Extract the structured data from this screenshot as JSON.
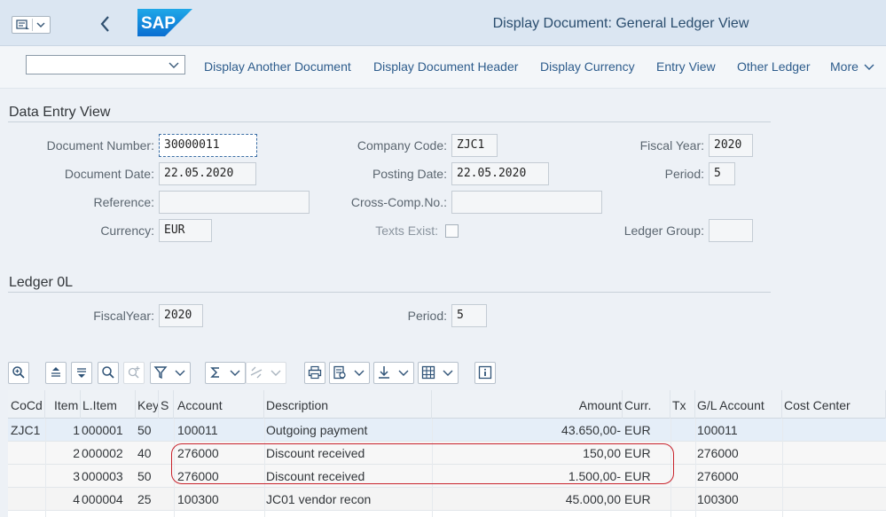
{
  "shell": {
    "title": "Display Document: General Ledger View",
    "logo_text": "SAP"
  },
  "toolbar": {
    "select_value": "",
    "actions": [
      "Display Another Document",
      "Display Document Header",
      "Display Currency",
      "Entry View",
      "Other Ledger"
    ],
    "more_label": "More"
  },
  "data_entry": {
    "title": "Data Entry View",
    "document_number": {
      "label": "Document Number:",
      "value": "30000011"
    },
    "company_code": {
      "label": "Company Code:",
      "value": "ZJC1"
    },
    "fiscal_year": {
      "label": "Fiscal Year:",
      "value": "2020"
    },
    "document_date": {
      "label": "Document Date:",
      "value": "22.05.2020"
    },
    "posting_date": {
      "label": "Posting Date:",
      "value": "22.05.2020"
    },
    "period": {
      "label": "Period:",
      "value": "5"
    },
    "reference": {
      "label": "Reference:",
      "value": ""
    },
    "cross_comp": {
      "label": "Cross-Comp.No.:",
      "value": ""
    },
    "currency": {
      "label": "Currency:",
      "value": "EUR"
    },
    "texts_exist": {
      "label": "Texts Exist:",
      "checked": false
    },
    "ledger_group": {
      "label": "Ledger Group:",
      "value": ""
    }
  },
  "ledger": {
    "title": "Ledger 0L",
    "fiscal_year": {
      "label": "FiscalYear:",
      "value": "2020"
    },
    "period": {
      "label": "Period:",
      "value": "5"
    }
  },
  "grid": {
    "columns": {
      "cocd": "CoCd",
      "item": "Item",
      "litem": "L.Item",
      "key": "Key",
      "s": "S",
      "account": "Account",
      "description": "Description",
      "amount": "Amount",
      "curr": "Curr.",
      "tx": "Tx",
      "gl": "G/L Account",
      "cc": "Cost Center"
    },
    "rows": [
      {
        "cocd": "ZJC1",
        "item": "1",
        "litem": "000001",
        "key": "50",
        "s": "",
        "account": "100011",
        "description": "Outgoing payment",
        "amount": "43.650,00-",
        "curr": "EUR",
        "tx": "",
        "gl": "100011",
        "cc": ""
      },
      {
        "cocd": "",
        "item": "2",
        "litem": "000002",
        "key": "40",
        "s": "",
        "account": "276000",
        "description": "Discount received",
        "amount": "150,00",
        "curr": "EUR",
        "tx": "",
        "gl": "276000",
        "cc": ""
      },
      {
        "cocd": "",
        "item": "3",
        "litem": "000003",
        "key": "50",
        "s": "",
        "account": "276000",
        "description": "Discount received",
        "amount": "1.500,00-",
        "curr": "EUR",
        "tx": "",
        "gl": "276000",
        "cc": ""
      },
      {
        "cocd": "",
        "item": "4",
        "litem": "000004",
        "key": "25",
        "s": "",
        "account": "100300",
        "description": "JC01 vendor recon",
        "amount": "45.000,00",
        "curr": "EUR",
        "tx": "",
        "gl": "100300",
        "cc": ""
      }
    ]
  },
  "colors": {
    "brand": "#0a6ed1",
    "highlight": "#c8232c",
    "link": "#2d5c8c"
  }
}
